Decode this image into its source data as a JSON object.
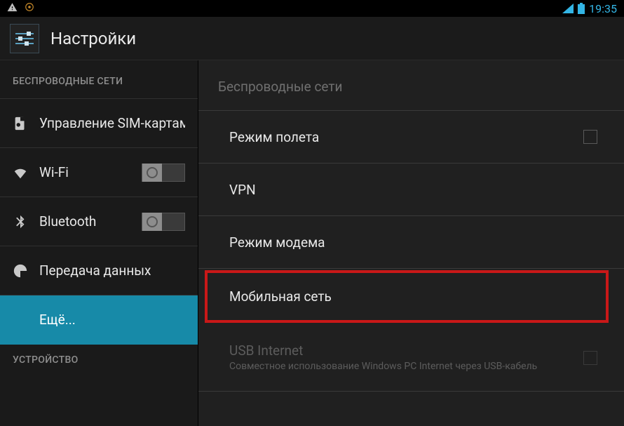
{
  "statusbar": {
    "time": "19:35"
  },
  "actionbar": {
    "title": "Настройки"
  },
  "sidebar": {
    "section_wireless": "БЕСПРОВОДНЫЕ СЕТИ",
    "section_device": "УСТРОЙСТВО",
    "items": {
      "sim": "Управление SIM-картам",
      "wifi": "Wi-Fi",
      "bluetooth": "Bluetooth",
      "data": "Передача данных",
      "more": "Ещё..."
    }
  },
  "detail": {
    "header": "Беспроводные сети",
    "airplane": "Режим полета",
    "vpn": "VPN",
    "tether": "Режим модема",
    "mobile": "Мобильная сеть",
    "usb_title": "USB Internet",
    "usb_sub": "Совместное использование Windows PC Internet через USB-кабель"
  }
}
